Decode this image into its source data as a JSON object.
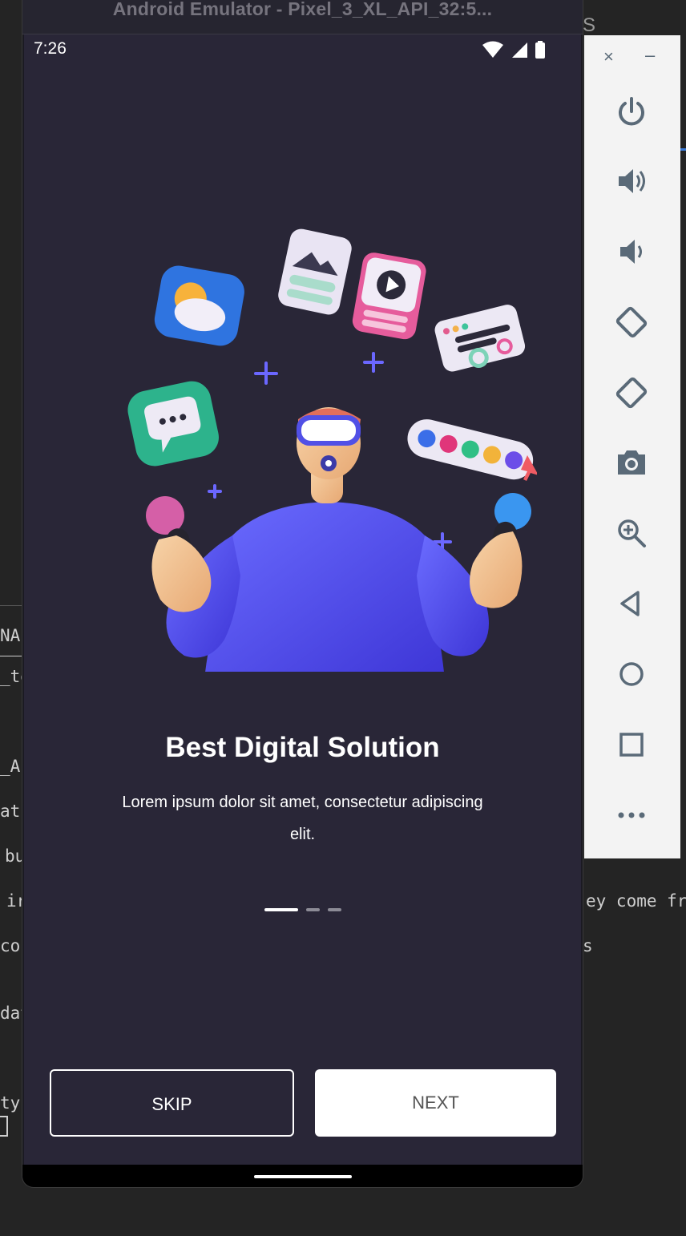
{
  "emulator": {
    "window_title": "Android Emulator - Pixel_3_XL_API_32:5...",
    "status_bar": {
      "time": "7:26",
      "icons": [
        "wifi-icon",
        "signal-icon",
        "battery-icon"
      ]
    }
  },
  "onboarding": {
    "illustration": "vr-person-illustration",
    "title": "Best Digital Solution",
    "subtitle": "Lorem ipsum dolor sit amet, consectetur adipiscing elit.",
    "page_indicator": {
      "pages": 3,
      "current": 1
    },
    "skip_label": "SKIP",
    "next_label": "NEXT"
  },
  "toolbar": {
    "close_symbol": "×",
    "minimize_symbol": "–",
    "buttons": [
      "power-icon",
      "volume-up-icon",
      "volume-down-icon",
      "rotate-left-icon",
      "rotate-right-icon",
      "camera-icon",
      "zoom-icon",
      "back-icon",
      "home-icon",
      "overview-icon",
      "more-icon"
    ]
  },
  "background_fragments": [
    "S",
    "NAI",
    "_te",
    "_A",
    "at",
    "bu",
    "ir",
    "cor",
    "dat",
    "ty",
    "ey come fr",
    "s"
  ],
  "colors": {
    "screen_bg": "#292637",
    "accent_purple": "#5b5ff0",
    "button_bg": "#ffffff"
  }
}
